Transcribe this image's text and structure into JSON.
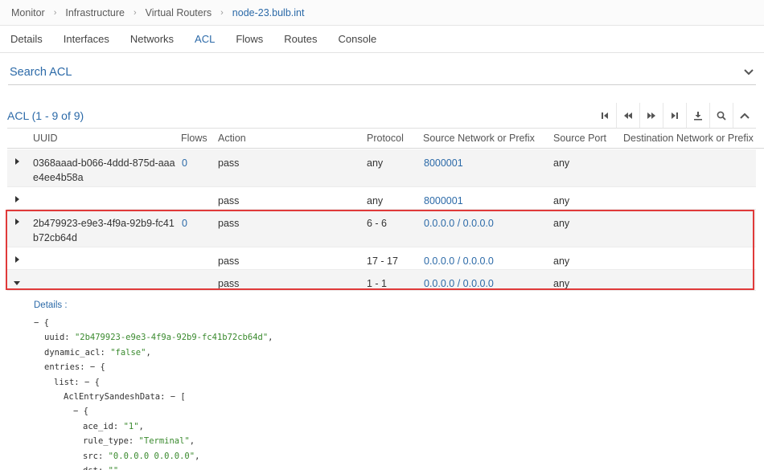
{
  "breadcrumb": {
    "items": [
      "Monitor",
      "Infrastructure",
      "Virtual Routers"
    ],
    "current": "node-23.bulb.int"
  },
  "tabs": [
    {
      "label": "Details",
      "active": false
    },
    {
      "label": "Interfaces",
      "active": false
    },
    {
      "label": "Networks",
      "active": false
    },
    {
      "label": "ACL",
      "active": true
    },
    {
      "label": "Flows",
      "active": false
    },
    {
      "label": "Routes",
      "active": false
    },
    {
      "label": "Console",
      "active": false
    }
  ],
  "search": {
    "title": "Search ACL"
  },
  "grid": {
    "title": "ACL (1 - 9 of 9)",
    "columns": [
      "UUID",
      "Flows",
      "Action",
      "Protocol",
      "Source Network or Prefix",
      "Source Port",
      "Destination Network or Prefix"
    ],
    "rows": [
      {
        "uuid": "0368aaad-b066-4ddd-875d-aaae4ee4b58a",
        "flows": "0",
        "action": "pass",
        "protocol": "any",
        "src_net": "8000001",
        "src_port": "any",
        "expanded": false
      },
      {
        "uuid": "",
        "flows": "",
        "action": "pass",
        "protocol": "any",
        "src_net": "8000001",
        "src_port": "any",
        "expanded": false
      },
      {
        "uuid": "2b479923-e9e3-4f9a-92b9-fc41b72cb64d",
        "flows": "0",
        "action": "pass",
        "protocol": "6 - 6",
        "src_net": "0.0.0.0 / 0.0.0.0",
        "src_port": "any",
        "expanded": false
      },
      {
        "uuid": "",
        "flows": "",
        "action": "pass",
        "protocol": "17 - 17",
        "src_net": "0.0.0.0 / 0.0.0.0",
        "src_port": "any",
        "expanded": false
      },
      {
        "uuid": "",
        "flows": "",
        "action": "pass",
        "protocol": "1 - 1",
        "src_net": "0.0.0.0 / 0.0.0.0",
        "src_port": "any",
        "expanded": true
      }
    ]
  },
  "details": {
    "label": "Details :",
    "json_lines": [
      {
        "indent": 0,
        "key": "",
        "value": "",
        "punct": "− {"
      },
      {
        "indent": 1,
        "key": "uuid: ",
        "value": "\"2b479923-e9e3-4f9a-92b9-fc41b72cb64d\"",
        "punct": ","
      },
      {
        "indent": 1,
        "key": "dynamic_acl: ",
        "value": "\"false\"",
        "punct": ","
      },
      {
        "indent": 1,
        "key": "entries: ",
        "value": "",
        "punct": "− {"
      },
      {
        "indent": 2,
        "key": "list: ",
        "value": "",
        "punct": "− {"
      },
      {
        "indent": 3,
        "key": "AclEntrySandeshData: ",
        "value": "",
        "punct": "− ["
      },
      {
        "indent": 4,
        "key": "",
        "value": "",
        "punct": "− {"
      },
      {
        "indent": 5,
        "key": "ace_id: ",
        "value": "\"1\"",
        "punct": ","
      },
      {
        "indent": 5,
        "key": "rule_type: ",
        "value": "\"Terminal\"",
        "punct": ","
      },
      {
        "indent": 5,
        "key": "src: ",
        "value": "\"0.0.0.0 0.0.0.0\"",
        "punct": ","
      },
      {
        "indent": 5,
        "key": "dst: ",
        "value": "\"\"",
        "punct": ","
      }
    ]
  }
}
